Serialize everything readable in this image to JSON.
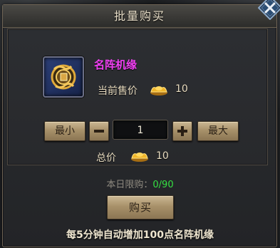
{
  "dialog": {
    "title": "批量购买"
  },
  "item": {
    "name": "名阵机缘",
    "name_color": "#f040f2",
    "icon": "scroll-token-icon"
  },
  "price": {
    "label": "当前售价",
    "currency_icon": "gold-ingot-icon",
    "value": "10"
  },
  "quantity": {
    "min_label": "最小",
    "max_label": "最大",
    "decrement_icon": "minus-icon",
    "increment_icon": "plus-icon",
    "value": "1"
  },
  "total": {
    "label": "总价",
    "currency_icon": "gold-ingot-icon",
    "value": "10"
  },
  "daily_limit": {
    "label": "本日限购：",
    "value": "0/90",
    "value_color": "#35e042"
  },
  "buy_button": {
    "label": "购买"
  },
  "footer": {
    "text": "每5分钟自动增加100点名阵机缘"
  }
}
